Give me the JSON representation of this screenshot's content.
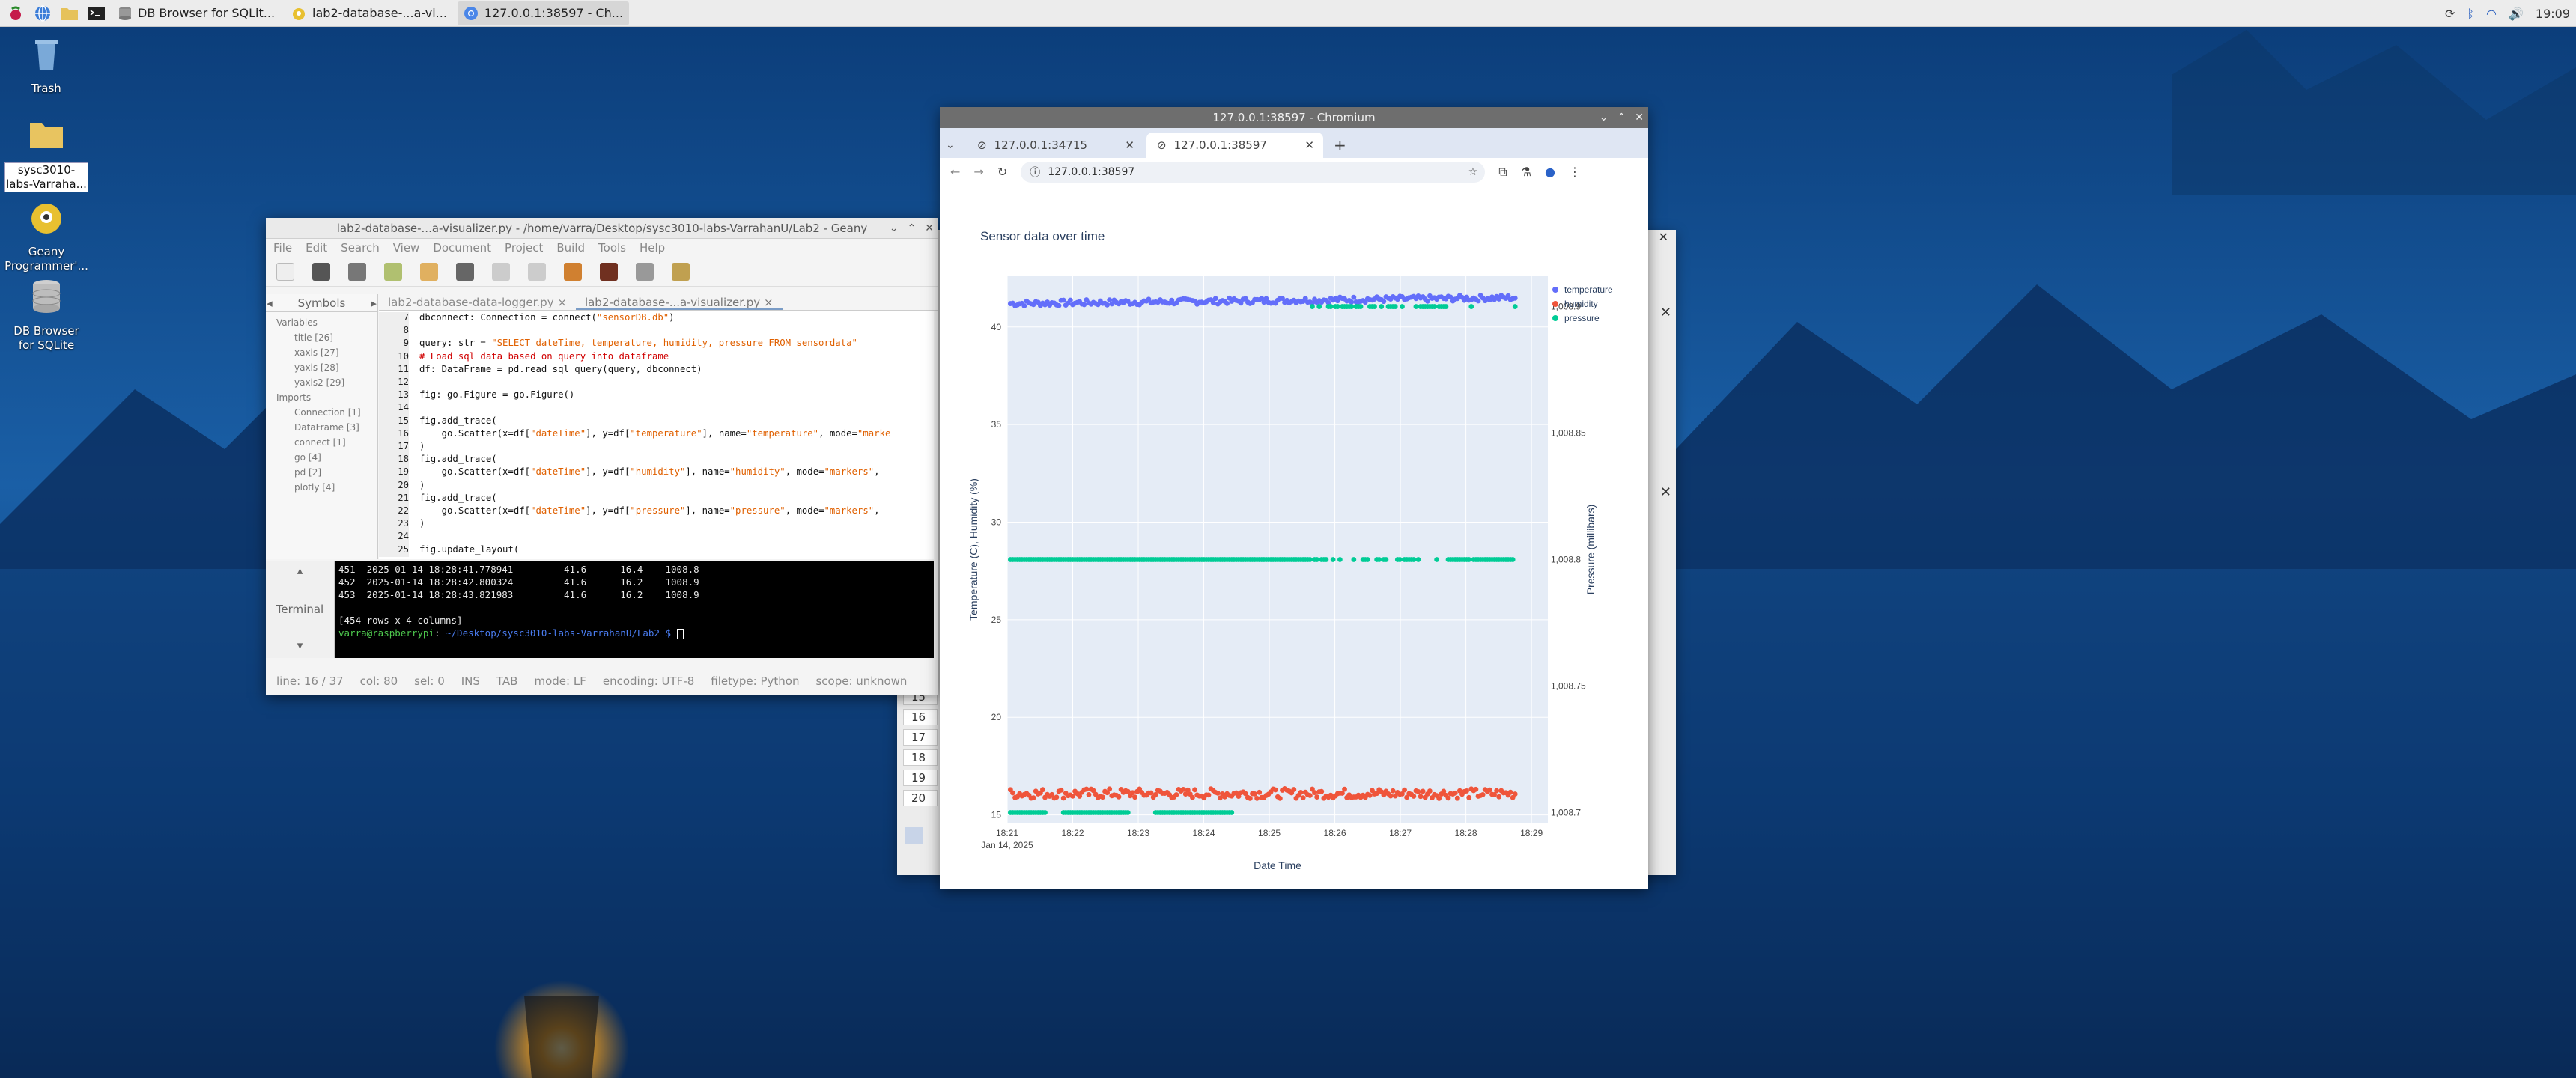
{
  "taskbar": {
    "tasks": [
      {
        "label": "DB Browser for SQLit..."
      },
      {
        "label": "lab2-database-...a-vi..."
      },
      {
        "label": "127.0.0.1:38597 - Ch..."
      }
    ],
    "clock": "19:09"
  },
  "desktop": {
    "icons": [
      {
        "label": "Trash"
      },
      {
        "label": "sysc3010-labs-Varraha..."
      },
      {
        "label": "Geany Programmer'..."
      },
      {
        "label": "DB Browser for SQLite"
      }
    ]
  },
  "geany": {
    "title": "lab2-database-...a-visualizer.py - /home/varra/Desktop/sysc3010-labs-VarrahanU/Lab2 - Geany",
    "menu": [
      "File",
      "Edit",
      "Search",
      "View",
      "Document",
      "Project",
      "Build",
      "Tools",
      "Help"
    ],
    "sidebar_tabs": [
      "Symbols"
    ],
    "symbols": [
      "Variables",
      "title [26]",
      "xaxis [27]",
      "yaxis [28]",
      "yaxis2 [29]",
      "Imports",
      "Connection [1]",
      "DataFrame [3]",
      "connect [1]",
      "go [4]",
      "pd [2]",
      "plotly [4]"
    ],
    "doc_tabs": [
      "lab2-database-data-logger.py",
      "lab2-database-...a-visualizer.py"
    ],
    "code_lines": [
      {
        "n": "7",
        "parts": [
          {
            "t": "dbconnect: Connection = connect(",
            "c": ""
          },
          {
            "t": "\"sensorDB.db\"",
            "c": "str"
          },
          {
            "t": ")",
            "c": ""
          }
        ]
      },
      {
        "n": "8",
        "parts": []
      },
      {
        "n": "9",
        "parts": [
          {
            "t": "query: str = ",
            "c": ""
          },
          {
            "t": "\"SELECT dateTime, temperature, humidity, pressure FROM sensordata\"",
            "c": "str"
          }
        ]
      },
      {
        "n": "10",
        "parts": [
          {
            "t": "# Load sql data based on query into dataframe",
            "c": "cmt"
          }
        ]
      },
      {
        "n": "11",
        "parts": [
          {
            "t": "df: DataFrame = pd.read_sql_query(query, dbconnect)",
            "c": ""
          }
        ]
      },
      {
        "n": "12",
        "parts": []
      },
      {
        "n": "13",
        "parts": [
          {
            "t": "fig: go.Figure = go.Figure()",
            "c": ""
          }
        ]
      },
      {
        "n": "14",
        "parts": []
      },
      {
        "n": "15",
        "parts": [
          {
            "t": "fig.add_trace(",
            "c": ""
          }
        ]
      },
      {
        "n": "16",
        "parts": [
          {
            "t": "    go.Scatter(x=df[",
            "c": ""
          },
          {
            "t": "\"dateTime\"",
            "c": "str"
          },
          {
            "t": "], y=df[",
            "c": ""
          },
          {
            "t": "\"temperature\"",
            "c": "str"
          },
          {
            "t": "], name=",
            "c": ""
          },
          {
            "t": "\"temperature\"",
            "c": "str"
          },
          {
            "t": ", mode=",
            "c": ""
          },
          {
            "t": "\"marke",
            "c": "str"
          }
        ]
      },
      {
        "n": "17",
        "parts": [
          {
            "t": ")",
            "c": ""
          }
        ]
      },
      {
        "n": "18",
        "parts": [
          {
            "t": "fig.add_trace(",
            "c": ""
          }
        ]
      },
      {
        "n": "19",
        "parts": [
          {
            "t": "    go.Scatter(x=df[",
            "c": ""
          },
          {
            "t": "\"dateTime\"",
            "c": "str"
          },
          {
            "t": "], y=df[",
            "c": ""
          },
          {
            "t": "\"humidity\"",
            "c": "str"
          },
          {
            "t": "], name=",
            "c": ""
          },
          {
            "t": "\"humidity\"",
            "c": "str"
          },
          {
            "t": ", mode=",
            "c": ""
          },
          {
            "t": "\"markers\"",
            "c": "str"
          },
          {
            "t": ", ",
            "c": ""
          }
        ]
      },
      {
        "n": "20",
        "parts": [
          {
            "t": ")",
            "c": ""
          }
        ]
      },
      {
        "n": "21",
        "parts": [
          {
            "t": "fig.add_trace(",
            "c": ""
          }
        ]
      },
      {
        "n": "22",
        "parts": [
          {
            "t": "    go.Scatter(x=df[",
            "c": ""
          },
          {
            "t": "\"dateTime\"",
            "c": "str"
          },
          {
            "t": "], y=df[",
            "c": ""
          },
          {
            "t": "\"pressure\"",
            "c": "str"
          },
          {
            "t": "], name=",
            "c": ""
          },
          {
            "t": "\"pressure\"",
            "c": "str"
          },
          {
            "t": ", mode=",
            "c": ""
          },
          {
            "t": "\"markers\"",
            "c": "str"
          },
          {
            "t": ", ",
            "c": ""
          }
        ]
      },
      {
        "n": "23",
        "parts": [
          {
            "t": ")",
            "c": ""
          }
        ]
      },
      {
        "n": "24",
        "parts": []
      },
      {
        "n": "25",
        "parts": [
          {
            "t": "fig.update_layout(",
            "c": ""
          }
        ]
      }
    ],
    "terminal_tab": "Terminal",
    "terminal_lines": [
      "451  2025-01-14 18:28:41.778941         41.6      16.4    1008.8",
      "452  2025-01-14 18:28:42.800324         41.6      16.2    1008.9",
      "453  2025-01-14 18:28:43.821983         41.6      16.2    1008.9",
      "",
      "[454 rows x 4 columns]"
    ],
    "prompt_user": "varra@raspberrypi",
    "prompt_path": "~/Desktop/sysc3010-labs-VarrahanU/Lab2 $",
    "status": [
      "line: 16 / 37",
      "col: 80",
      "sel: 0",
      "INS",
      "TAB",
      "mode: LF",
      "encoding: UTF-8",
      "filetype: Python",
      "scope: unknown"
    ]
  },
  "dbrows": [
    "15",
    "16",
    "17",
    "18",
    "19",
    "20"
  ],
  "chromium": {
    "title": "127.0.0.1:38597 - Chromium",
    "tabs": [
      "127.0.0.1:34715",
      "127.0.0.1:38597"
    ],
    "url": "127.0.0.1:38597"
  },
  "chart_data": {
    "type": "scatter",
    "title": "Sensor data over time",
    "xlabel": "Date Time",
    "ylabel": "Temperature (C), Humidity (%)",
    "y2label": "Pressure (millibars)",
    "x_ticks": [
      "18:21",
      "18:22",
      "18:23",
      "18:24",
      "18:25",
      "18:26",
      "18:27",
      "18:28",
      "18:29"
    ],
    "x_date_label": "Jan 14, 2025",
    "y_ticks": [
      15,
      20,
      25,
      30,
      35,
      40
    ],
    "ylim": [
      14.6,
      42.6
    ],
    "y2_ticks": [
      "1,008.7",
      "1,008.75",
      "1,008.8",
      "1,008.85",
      "1,008.9"
    ],
    "y2lim": [
      1008.696,
      1008.912
    ],
    "xlim_minutes": [
      0,
      8.25
    ],
    "legend_position": "top-right",
    "grid": true,
    "series": [
      {
        "name": "temperature",
        "color": "#636efa",
        "x_range_minutes": [
          0.05,
          7.75
        ],
        "y_start": 41.2,
        "y_end": 41.5,
        "jitter": 0.15,
        "count": 454
      },
      {
        "name": "humidity",
        "color": "#ef553b",
        "x_range_minutes": [
          0.05,
          7.75
        ],
        "y_center": 16.1,
        "jitter": 0.25,
        "count": 454
      },
      {
        "name": "pressure",
        "color": "#00cc96",
        "x_range_minutes": [
          0.05,
          7.75
        ],
        "y_levels": [
          1008.7,
          1008.8,
          1008.9
        ],
        "count": 454
      }
    ]
  }
}
